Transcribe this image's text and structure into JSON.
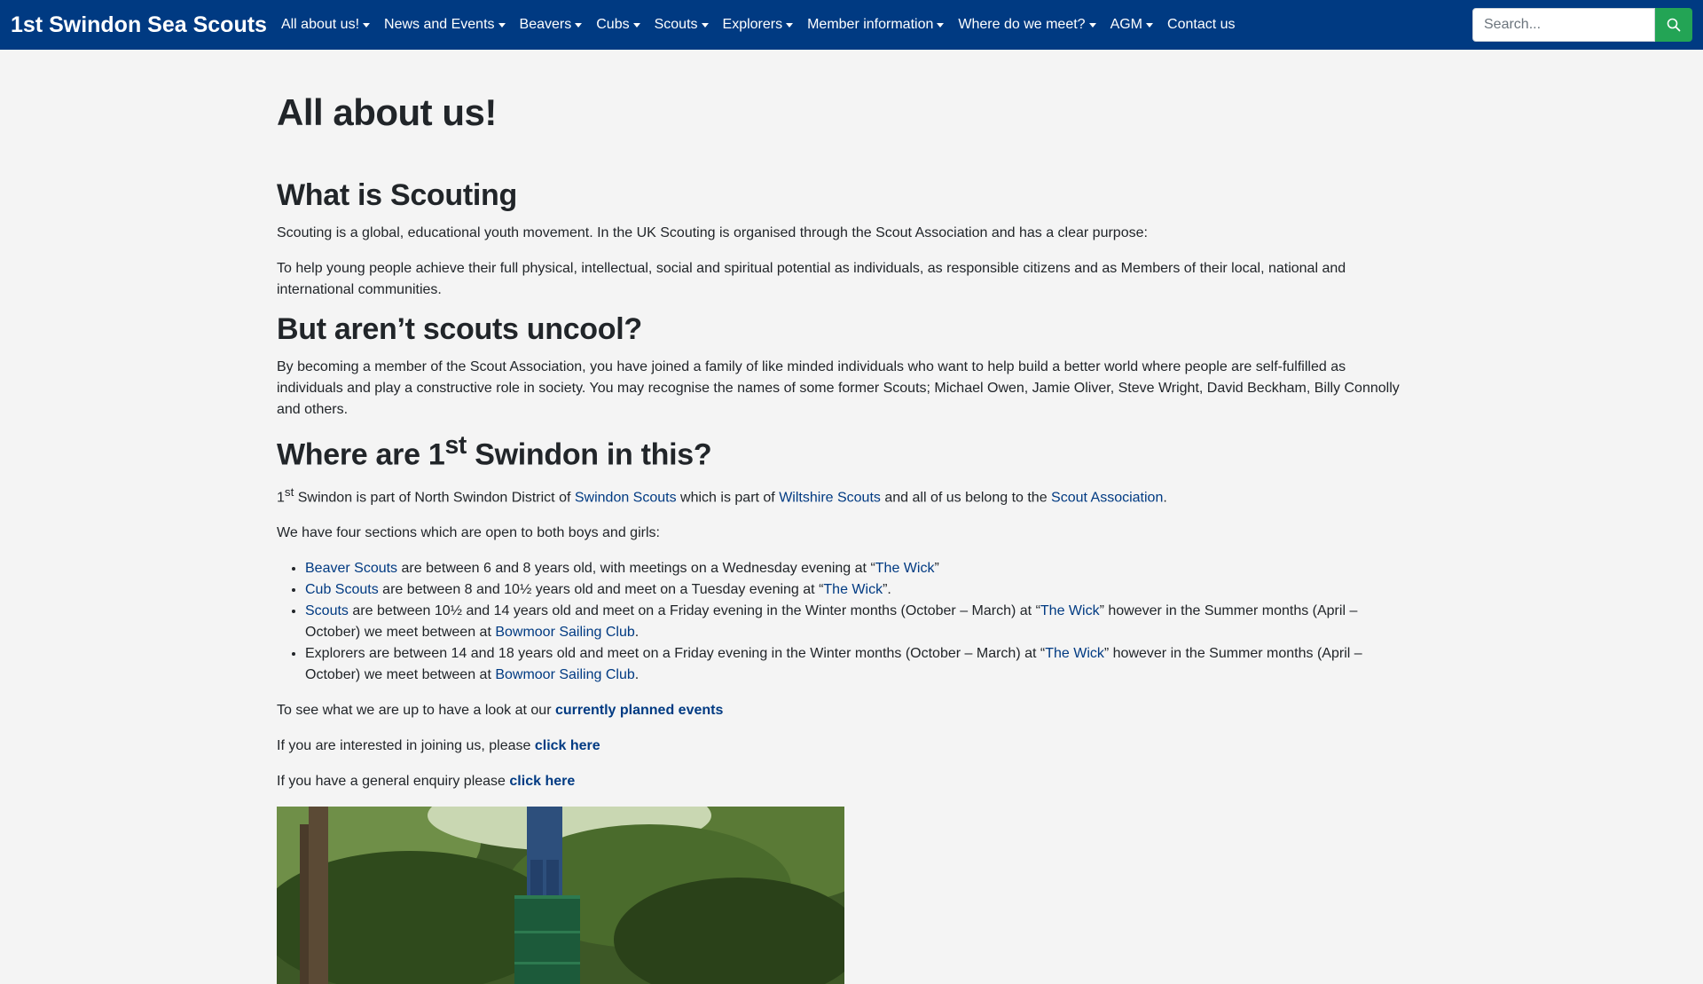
{
  "site": {
    "brand": "1st Swindon Sea Scouts"
  },
  "nav": {
    "items": [
      {
        "label": "All about us!",
        "dropdown": true
      },
      {
        "label": "News and Events",
        "dropdown": true
      },
      {
        "label": "Beavers",
        "dropdown": true
      },
      {
        "label": "Cubs",
        "dropdown": true
      },
      {
        "label": "Scouts",
        "dropdown": true
      },
      {
        "label": "Explorers",
        "dropdown": true
      },
      {
        "label": "Member information",
        "dropdown": true
      },
      {
        "label": "Where do we meet?",
        "dropdown": true
      },
      {
        "label": "AGM",
        "dropdown": true
      },
      {
        "label": "Contact us",
        "dropdown": false
      }
    ],
    "search_placeholder": "Search..."
  },
  "colors": {
    "navbar": "#003a82",
    "search_button": "#23a455",
    "link": "#003a82",
    "background": "#f4f4f4"
  },
  "page": {
    "title": "All about us!",
    "s1": {
      "heading": "What is Scouting",
      "p1": "Scouting is a global, educational youth movement. In the UK Scouting is organised through the Scout Association and has a clear purpose:",
      "p2": "To help young people achieve their full physical, intellectual, social and spiritual potential as individuals, as responsible citizens and as Members of their local, national and international communities."
    },
    "s2": {
      "heading": "But aren’t scouts uncool?",
      "p1": "By becoming a member of the Scout Association, you have joined a family of like minded individuals who want to help build a better world where people are self-fulfilled as individuals and play a constructive role in society. You may recognise the names of some former Scouts; Michael Owen, Jamie Oliver, Steve Wright, David Beckham, Billy Connolly and others."
    },
    "s3": {
      "heading_pre": "Where are 1",
      "heading_sup": "st",
      "heading_post": " Swindon in this?",
      "intro": {
        "t1": "1",
        "sup": "st",
        "t2": " Swindon is part of North Swindon District of ",
        "link1": "Swindon Scouts",
        "t3": " which is part of ",
        "link2": "Wiltshire Scouts",
        "t4": " and all of us belong to the ",
        "link3": "Scout Association",
        "t5": "."
      },
      "sections_intro": "We have four sections which are open to both boys and girls:",
      "list": {
        "beavers": {
          "link": "Beaver Scouts",
          "t1": " are between 6 and 8 years old, with meetings on a Wednesday evening at “",
          "wick": "The Wick",
          "t2": "”"
        },
        "cubs": {
          "link": "Cub Scouts",
          "t1": " are between 8 and 10½ years old and meet on a Tuesday evening  at “",
          "wick": "The Wick",
          "t2": "”."
        },
        "scouts": {
          "link": "Scouts",
          "t1": " are between 10½ and 14 years old and meet on a Friday evening in the Winter months (October – March)  at “",
          "wick": "The Wick",
          "t2": "” however in the Summer months (April – October) we meet between at  ",
          "club": "Bowmoor Sailing Club",
          "t3": "."
        },
        "explorers": {
          "t1": "Explorers are between 14 and 18 years old and meet on a Friday evening in the Winter months (October – March) at “",
          "wick": "The Wick",
          "t2": "” however in the Summer months (April – October) we meet between at ",
          "club": "Bowmoor Sailing Club",
          "t3": "."
        }
      },
      "events": {
        "t1": "To see what we are up to have a look at our ",
        "link": "currently planned events"
      },
      "join": {
        "t1": "If you are interested in joining us, please ",
        "link": "click here"
      },
      "enquiry": {
        "t1": "If you have a general enquiry please ",
        "link": "click here"
      }
    }
  }
}
